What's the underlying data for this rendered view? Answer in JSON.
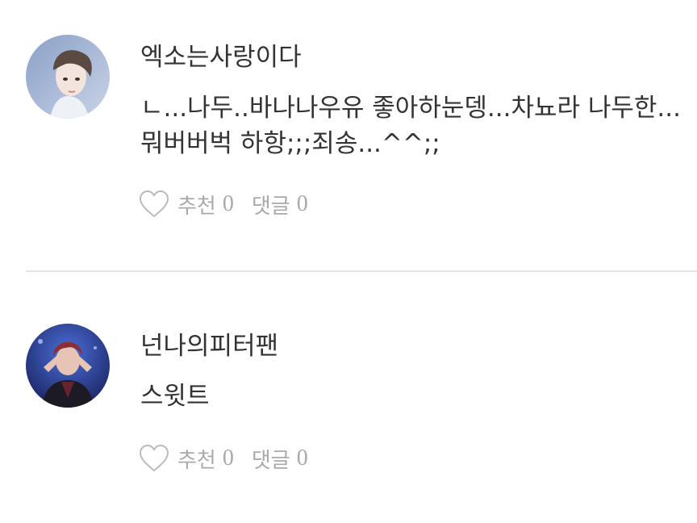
{
  "comments": [
    {
      "author": "엑소는사랑이다",
      "text": "ㄴ...나두..바나나우유 좋아하눈뎅...차뇨라 나두한...뭐버버벅 하항;;;죄송...^^;;",
      "like_label": "추천",
      "like_count": "0",
      "reply_label": "댓글",
      "reply_count": "0"
    },
    {
      "author": "넌나의피터팬",
      "text": "스윗트",
      "like_label": "추천",
      "like_count": "0",
      "reply_label": "댓글",
      "reply_count": "0"
    }
  ],
  "icons": {
    "like": "heart-outline-icon"
  },
  "colors": {
    "text": "#333333",
    "meta": "#aaaaaa",
    "divider": "#e6e6e6"
  }
}
